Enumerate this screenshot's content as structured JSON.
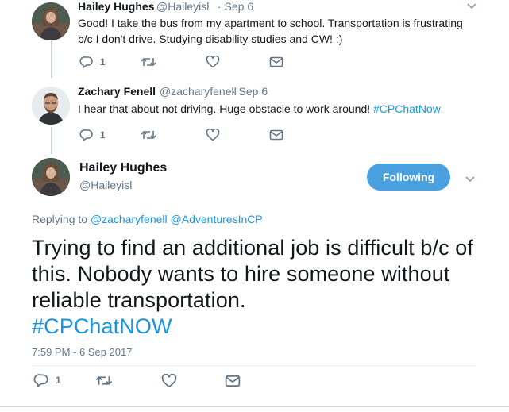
{
  "tweets": [
    {
      "display_name": "Hailey Hughes",
      "handle": "@Haileyisl",
      "time": "· Sep 6",
      "text": "Good! I take the bus from my apartment to school. Transportation is frustrating b/c I don't drive. Studying disability studies and CW! :)",
      "reply_count": "1"
    },
    {
      "display_name": "Zachary Fenell",
      "handle": "@zacharyfenell",
      "time": "· Sep 6",
      "text": "I hear that about not driving. Huge obstacle to work around!",
      "hashtag": "#CPChatNow",
      "reply_count": "1"
    }
  ],
  "main_tweet": {
    "display_name": "Hailey Hughes",
    "handle": "@Haileyisl",
    "follow_label": "Following",
    "replying_to_label": "Replying to",
    "reply_mention_1": "@zacharyfenell",
    "reply_mention_2": "@AdventuresInCP",
    "text": "Trying to find an additional job is difficult b/c of this. Nobody wants to hire someone without reliable transportation.",
    "hashtag": "#CPChatNOW",
    "timestamp": "7:59 PM - 6 Sep 2017",
    "reply_count": "1"
  },
  "colors": {
    "link": "#1b95e0",
    "follow_button": "#4ba0e0",
    "muted": "#657786"
  },
  "icons": [
    "reply-icon",
    "retweet-icon",
    "like-icon",
    "direct-message-icon",
    "chevron-down-icon"
  ]
}
